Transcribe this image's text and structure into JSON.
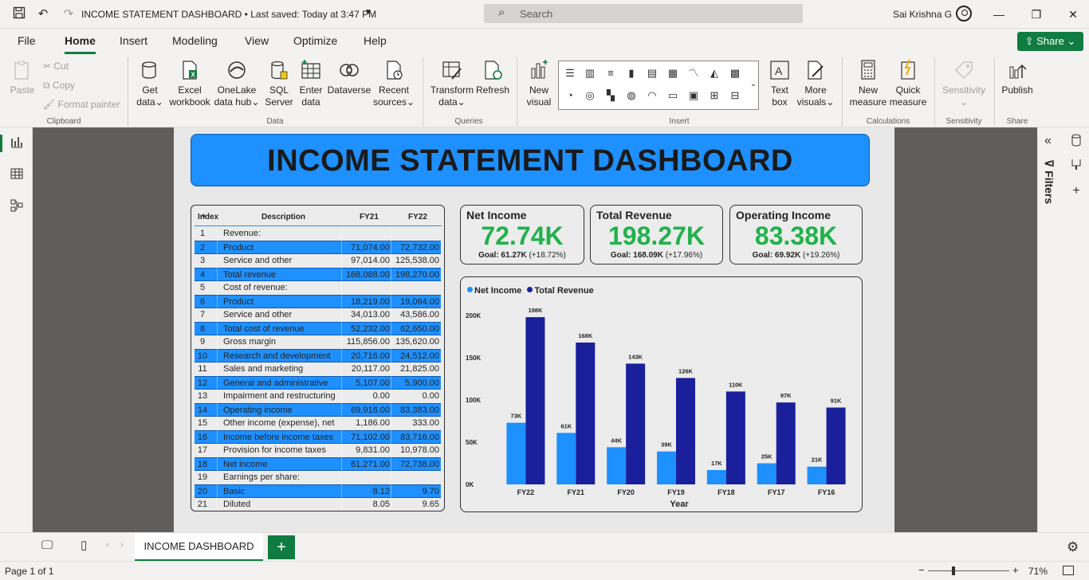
{
  "titlebar": {
    "doc_title": "INCOME STATEMENT DASHBOARD • Last saved: Today at 3:47 PM",
    "search_placeholder": "Search",
    "user_name": "Sai Krishna G"
  },
  "menu": {
    "tabs": [
      "File",
      "Home",
      "Insert",
      "Modeling",
      "View",
      "Optimize",
      "Help"
    ],
    "active": "Home",
    "share_label": "Share"
  },
  "ribbon": {
    "clipboard": {
      "paste": "Paste",
      "cut": "Cut",
      "copy": "Copy",
      "format_painter": "Format painter",
      "group": "Clipboard"
    },
    "data": {
      "get_data": [
        "Get",
        "data"
      ],
      "excel": [
        "Excel",
        "workbook"
      ],
      "onelake": [
        "OneLake",
        "data hub"
      ],
      "sql": [
        "SQL",
        "Server"
      ],
      "enter": [
        "Enter",
        "data"
      ],
      "dataverse": [
        "Dataverse",
        ""
      ],
      "recent": [
        "Recent",
        "sources"
      ],
      "group": "Data"
    },
    "queries": {
      "transform": [
        "Transform",
        "data"
      ],
      "refresh": [
        "Refresh",
        ""
      ],
      "group": "Queries"
    },
    "insert": {
      "new_visual": [
        "New",
        "visual"
      ],
      "text_box": [
        "Text",
        "box"
      ],
      "more_visuals": [
        "More",
        "visuals"
      ],
      "group": "Insert"
    },
    "calculations": {
      "new_measure": [
        "New",
        "measure"
      ],
      "quick_measure": [
        "Quick",
        "measure"
      ],
      "group": "Calculations"
    },
    "sensitivity": {
      "label": [
        "Sensitivity",
        ""
      ],
      "group": "Sensitivity"
    },
    "share": {
      "publish": [
        "Publish",
        ""
      ],
      "group": "Share"
    }
  },
  "dashboard": {
    "title": "INCOME STATEMENT DASHBOARD",
    "table": {
      "headers": {
        "index": "Index",
        "description": "Description",
        "fy21": "FY21",
        "fy22": "FY22"
      },
      "rows": [
        {
          "i": "1",
          "d": "Revenue:",
          "a": "",
          "b": "",
          "hl": false
        },
        {
          "i": "2",
          "d": "Product",
          "a": "71,074.00",
          "b": "72,732.00",
          "hl": true
        },
        {
          "i": "3",
          "d": "Service and other",
          "a": "97,014.00",
          "b": "125,538.00",
          "hl": false
        },
        {
          "i": "4",
          "d": "Total revenue",
          "a": "168,088.00",
          "b": "198,270.00",
          "hl": true
        },
        {
          "i": "5",
          "d": "Cost of revenue:",
          "a": "",
          "b": "",
          "hl": false
        },
        {
          "i": "6",
          "d": "Product",
          "a": "18,219.00",
          "b": "19,064.00",
          "hl": true
        },
        {
          "i": "7",
          "d": "Service and other",
          "a": "34,013.00",
          "b": "43,586.00",
          "hl": false
        },
        {
          "i": "8",
          "d": "Total cost of revenue",
          "a": "52,232.00",
          "b": "62,650.00",
          "hl": true
        },
        {
          "i": "9",
          "d": "Gross margin",
          "a": "115,856.00",
          "b": "135,620.00",
          "hl": false
        },
        {
          "i": "10",
          "d": "Research and development",
          "a": "20,716.00",
          "b": "24,512.00",
          "hl": true
        },
        {
          "i": "11",
          "d": "Sales and marketing",
          "a": "20,117.00",
          "b": "21,825.00",
          "hl": false
        },
        {
          "i": "12",
          "d": "General and administrative",
          "a": "5,107.00",
          "b": "5,900.00",
          "hl": true
        },
        {
          "i": "13",
          "d": "Impairment and restructuring",
          "a": "0.00",
          "b": "0.00",
          "hl": false
        },
        {
          "i": "14",
          "d": "Operating income",
          "a": "69,916.00",
          "b": "83,383.00",
          "hl": true
        },
        {
          "i": "15",
          "d": "Other income (expense), net",
          "a": "1,186.00",
          "b": "333.00",
          "hl": false
        },
        {
          "i": "16",
          "d": "Income before income taxes",
          "a": "71,102.00",
          "b": "83,716.00",
          "hl": true
        },
        {
          "i": "17",
          "d": "Provision for income taxes",
          "a": "9,831.00",
          "b": "10,978.00",
          "hl": false
        },
        {
          "i": "18",
          "d": "Net income",
          "a": "61,271.00",
          "b": "72,738.00",
          "hl": true
        },
        {
          "i": "19",
          "d": "Earnings per share:",
          "a": "",
          "b": "",
          "hl": false
        },
        {
          "i": "20",
          "d": "Basic",
          "a": "8.12",
          "b": "9.70",
          "hl": true
        },
        {
          "i": "21",
          "d": "Diluted",
          "a": "8.05",
          "b": "9.65",
          "hl": false
        }
      ]
    },
    "kpis": [
      {
        "title": "Net Income",
        "value": "72.74K",
        "goal_label": "Goal: 61.27K",
        "goal_delta": "(+18.72%)"
      },
      {
        "title": "Total Revenue",
        "value": "198.27K",
        "goal_label": "Goal: 168.09K",
        "goal_delta": "(+17.96%)"
      },
      {
        "title": "Operating Income",
        "value": "83.38K",
        "goal_label": "Goal: 69.92K",
        "goal_delta": "(+19.26%)"
      }
    ],
    "colors": {
      "accent": "#1e90ff",
      "kpi_value": "#22b14c",
      "net_income": "#1e90ff",
      "total_revenue": "#1a1f9c"
    }
  },
  "chart_data": {
    "type": "bar",
    "categories": [
      "FY22",
      "FY21",
      "FY20",
      "FY19",
      "FY18",
      "FY17",
      "FY16"
    ],
    "series": [
      {
        "name": "Net Income",
        "values": [
          73,
          61,
          44,
          39,
          17,
          25,
          21
        ],
        "labels": [
          "73K",
          "61K",
          "44K",
          "39K",
          "17K",
          "25K",
          "21K"
        ],
        "color": "#1e90ff"
      },
      {
        "name": "Total Revenue",
        "values": [
          198,
          168,
          143,
          126,
          110,
          97,
          91
        ],
        "labels": [
          "198K",
          "168K",
          "143K",
          "126K",
          "110K",
          "97K",
          "91K"
        ],
        "color": "#1a1f9c"
      }
    ],
    "xlabel": "Year",
    "ylabel": "",
    "ylim": [
      0,
      200
    ],
    "yticks": [
      0,
      50,
      100,
      150,
      200
    ],
    "ytick_labels": [
      "0K",
      "50K",
      "100K",
      "150K",
      "200K"
    ],
    "legend": "top-left",
    "grid": false
  },
  "right_pane": {
    "filters_label": "Filters"
  },
  "tabs": {
    "page_tab": "INCOME DASHBOARD",
    "add": "+"
  },
  "status": {
    "page_count": "Page 1 of 1",
    "zoom": "71%"
  }
}
